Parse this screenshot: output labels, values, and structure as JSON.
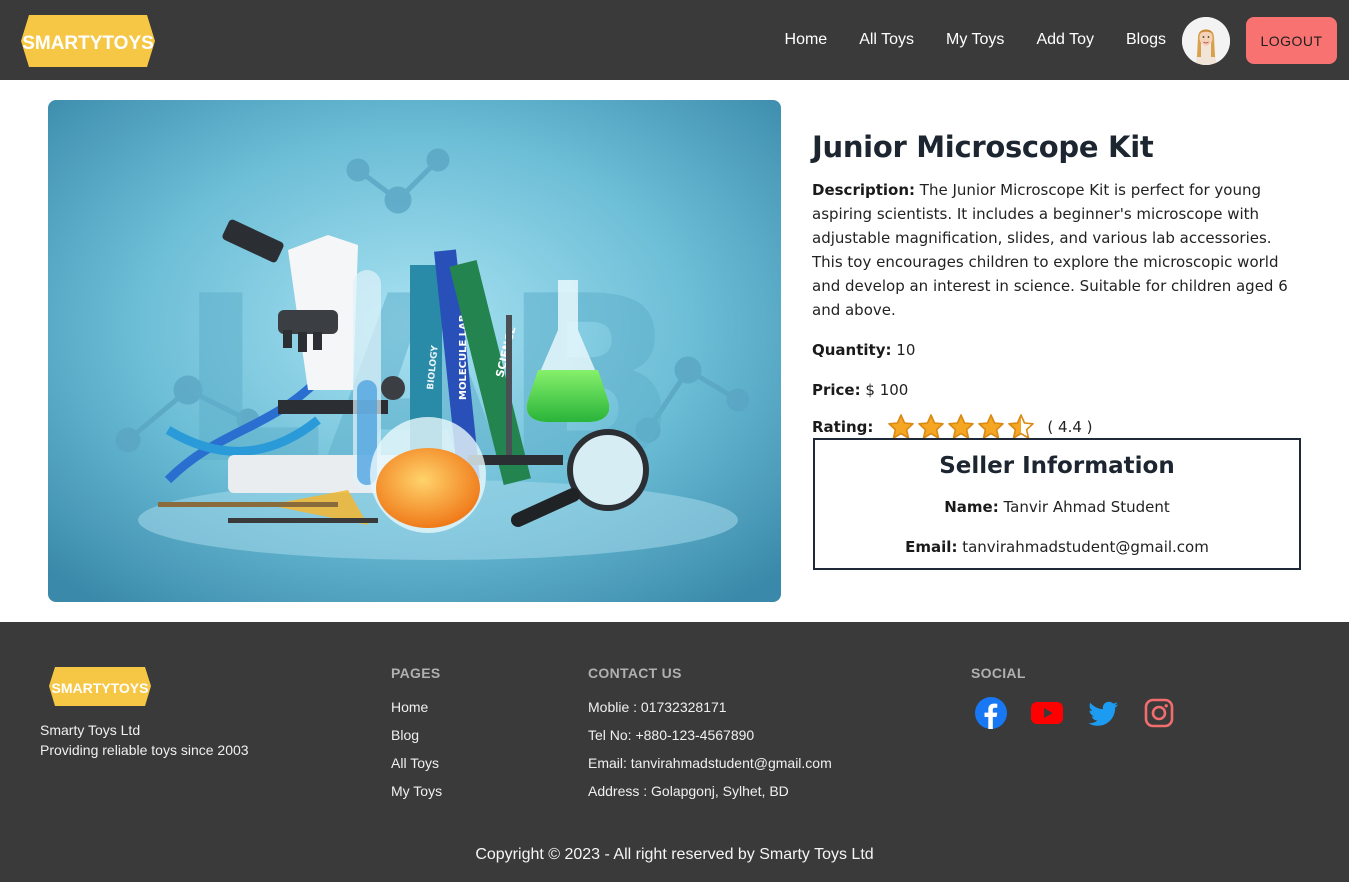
{
  "nav": {
    "logo_text": "SMARTYTOYS",
    "links": [
      "Home",
      "All Toys",
      "My Toys",
      "Add Toy",
      "Blogs"
    ],
    "logout_label": "LOGOUT"
  },
  "product": {
    "name": "Junior Microscope Kit",
    "description_label": "Description:",
    "description": "The Junior Microscope Kit is perfect for young aspiring scientists. It includes a beginner's microscope with adjustable magnification, slides, and various lab accessories. This toy encourages children to explore the microscopic world and develop an interest in science. Suitable for children aged 6 and above.",
    "quantity_label": "Quantity:",
    "quantity": "10",
    "price_label": "Price:",
    "price": "$ 100",
    "rating_label": "Rating:",
    "rating": 4.4,
    "rating_text": "( 4.4 )",
    "image_watermark": "LAB",
    "image_labels": [
      "BIOLOGY",
      "MOLECULE LAB",
      "SCIENCE"
    ]
  },
  "seller": {
    "title": "Seller Information",
    "name_label": "Name:",
    "name": "Tanvir Ahmad Student",
    "email_label": "Email:",
    "email": "tanvirahmadstudent@gmail.com"
  },
  "footer": {
    "logo_text": "SMARTYTOYS",
    "company_name": "Smarty Toys Ltd",
    "tagline": "Providing reliable toys since 2003",
    "pages_heading": "PAGES",
    "pages": [
      "Home",
      "Blog",
      "All Toys",
      "My Toys"
    ],
    "contact_heading": "CONTACT US",
    "contacts": [
      "Moblie : 01732328171",
      "Tel No: +880-123-4567890",
      "Email: tanvirahmadstudent@gmail.com",
      "Address : Golapgonj, Sylhet, BD"
    ],
    "social_heading": "SOCIAL",
    "social": [
      "facebook-icon",
      "youtube-icon",
      "twitter-icon",
      "instagram-icon"
    ],
    "copyright": "Copyright © 2023 - All right reserved by Smarty Toys Ltd"
  },
  "colors": {
    "navbar_bg": "#3a3a3a",
    "logout_bg": "#f87272",
    "logo_yellow": "#f6c744",
    "star": "#f5a623",
    "facebook": "#1877f2",
    "youtube": "#ff0000",
    "twitter": "#1d9bf0",
    "instagram": "#f26d6d"
  }
}
